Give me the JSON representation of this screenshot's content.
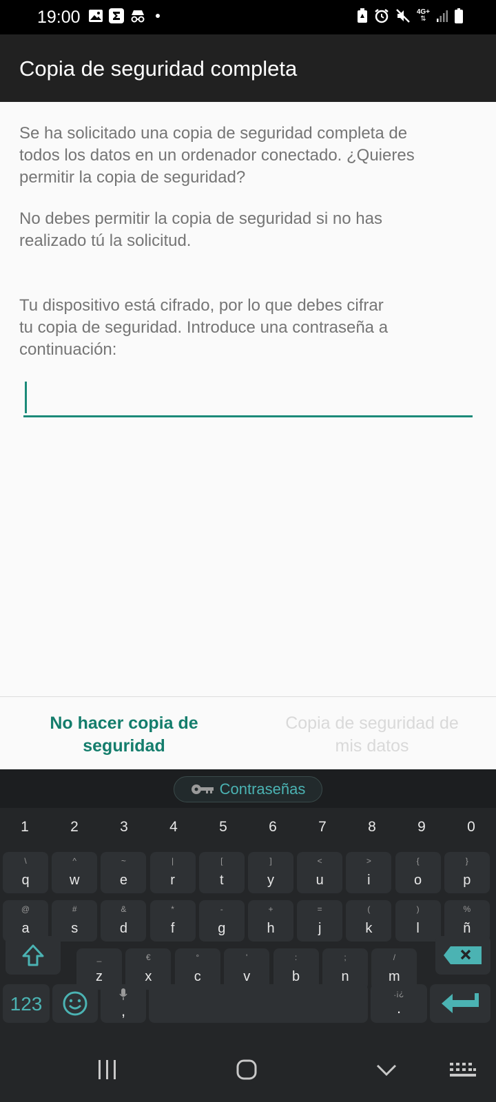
{
  "status_bar": {
    "time": "19:00",
    "network": "4G+"
  },
  "app_bar": {
    "title": "Copia de seguridad completa"
  },
  "content": {
    "paragraph_1": "Se ha solicitado una copia de seguridad completa de\ntodos los datos en un ordenador conectado. ¿Quieres\npermitir la copia de seguridad?",
    "paragraph_2": "No debes permitir la copia de seguridad si no has\nrealizado tú la solicitud.",
    "paragraph_3": "Tu dispositivo está cifrado, por lo que debes cifrar\ntu copia de seguridad. Introduce una contraseña a\ncontinuación:"
  },
  "password_field": {
    "value": ""
  },
  "buttons": {
    "deny": "No hacer copia de\nseguridad",
    "allow": "Copia de seguridad de\nmis datos"
  },
  "keyboard": {
    "suggestion_chip": "Contraseñas",
    "number_row": [
      "1",
      "2",
      "3",
      "4",
      "5",
      "6",
      "7",
      "8",
      "9",
      "0"
    ],
    "row1": [
      [
        "\\",
        "q"
      ],
      [
        "^",
        "w"
      ],
      [
        "~",
        "e"
      ],
      [
        "|",
        "r"
      ],
      [
        "[",
        "t"
      ],
      [
        "]",
        "y"
      ],
      [
        "<",
        "u"
      ],
      [
        ">",
        "i"
      ],
      [
        "{",
        "o"
      ],
      [
        "}",
        "p"
      ]
    ],
    "row2": [
      [
        "@",
        "a"
      ],
      [
        "#",
        "s"
      ],
      [
        "&",
        "d"
      ],
      [
        "*",
        "f"
      ],
      [
        "-",
        "g"
      ],
      [
        "+",
        "h"
      ],
      [
        "=",
        "j"
      ],
      [
        "(",
        "k"
      ],
      [
        ")",
        "l"
      ],
      [
        "%",
        "ñ"
      ]
    ],
    "row3": [
      [
        "_",
        "z"
      ],
      [
        "€",
        "x"
      ],
      [
        "°",
        "c"
      ],
      [
        "'",
        "v"
      ],
      [
        ":",
        "b"
      ],
      [
        ";",
        "n"
      ],
      [
        "/",
        "m"
      ]
    ],
    "mode_key": "123",
    "comma_key": ",",
    "period_key": ".",
    "period_sym": ".¡¿",
    "accent_color": "#4bb3b3"
  },
  "colors": {
    "accent": "#147d6c",
    "disabled": "#d9d9d9",
    "body_text": "#757575"
  }
}
